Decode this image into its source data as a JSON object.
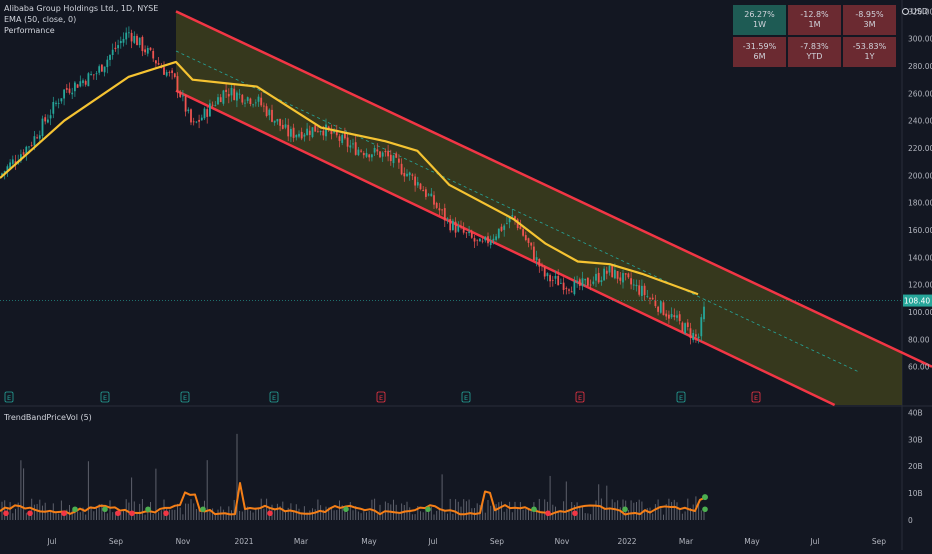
{
  "header": {
    "symbol_line": "Alibaba Group Holdings Ltd., 1D, NYSE",
    "ema_line": "EMA (50, close, 0)",
    "performance_line": "Performance"
  },
  "currency": "USD",
  "performance": [
    {
      "value": "26.27%",
      "period": "1W",
      "color": "#1e5b54"
    },
    {
      "value": "-12.8%",
      "period": "1M",
      "color": "#6b2a31"
    },
    {
      "value": "-8.95%",
      "period": "3M",
      "color": "#6b2a31"
    },
    {
      "value": "-31.59%",
      "period": "6M",
      "color": "#6b2a31"
    },
    {
      "value": "-7.83%",
      "period": "YTD",
      "color": "#6b2a31"
    },
    {
      "value": "-53.83%",
      "period": "1Y",
      "color": "#6b2a31"
    }
  ],
  "sub_pane_label": "TrendBandPriceVol (5)",
  "colors": {
    "background": "#131722",
    "channel": "#f23645",
    "channel_fill": "#3d3e1c",
    "ema": "#f5c332",
    "up": "#26a69a",
    "down": "#ef5350",
    "volume_line": "#f57f17",
    "dot_green": "#4caf50",
    "dot_red": "#f23645"
  },
  "chart_data": [
    {
      "type": "candlestick",
      "title": "Alibaba Group Holdings Ltd., 1D, NYSE",
      "y_axis_ticks": [
        60,
        80,
        100,
        120,
        140,
        160,
        180,
        200,
        220,
        240,
        260,
        280,
        300,
        320
      ],
      "ylim": [
        50,
        325
      ],
      "x_axis_ticks": [
        "Jul",
        "Sep",
        "Nov",
        "2021",
        "Mar",
        "May",
        "Jul",
        "Sep",
        "Nov",
        "2022",
        "Mar",
        "May",
        "Jul",
        "Sep"
      ],
      "last_price_label": "108.40",
      "price_path": [
        {
          "x": "Jun 2020",
          "y": 200
        },
        {
          "x": "Jul 2020",
          "y": 225
        },
        {
          "x": "Aug 2020",
          "y": 262
        },
        {
          "x": "Sep 2020",
          "y": 275
        },
        {
          "x": "Oct 2020",
          "y": 305
        },
        {
          "x": "Nov 2020",
          "y": 268
        },
        {
          "x": "Dec 2020",
          "y": 235
        },
        {
          "x": "Jan 2021",
          "y": 262
        },
        {
          "x": "Feb 2021",
          "y": 255
        },
        {
          "x": "Mar 2021",
          "y": 230
        },
        {
          "x": "Apr 2021",
          "y": 235
        },
        {
          "x": "May 2021",
          "y": 220
        },
        {
          "x": "Jun 2021",
          "y": 215
        },
        {
          "x": "Jul 2021",
          "y": 195
        },
        {
          "x": "Aug 2021",
          "y": 165
        },
        {
          "x": "Sep 2021",
          "y": 148
        },
        {
          "x": "Oct 2021",
          "y": 170
        },
        {
          "x": "Nov 2021",
          "y": 125
        },
        {
          "x": "Dec 2021",
          "y": 118
        },
        {
          "x": "Jan 2022",
          "y": 130
        },
        {
          "x": "Feb 2022",
          "y": 115
        },
        {
          "x": "Mar 2022",
          "y": 80
        },
        {
          "x": "Mar 2022 end",
          "y": 108
        }
      ],
      "ema_path": [
        {
          "x": "Jun 2020",
          "y": 198
        },
        {
          "x": "Aug 2020",
          "y": 240
        },
        {
          "x": "Oct 2020",
          "y": 272
        },
        {
          "x": "Nov 2020",
          "y": 283
        },
        {
          "x": "Dec 2020",
          "y": 270
        },
        {
          "x": "Feb 2021",
          "y": 265
        },
        {
          "x": "Apr 2021",
          "y": 235
        },
        {
          "x": "Jun 2021",
          "y": 225
        },
        {
          "x": "Jul 2021",
          "y": 218
        },
        {
          "x": "Aug 2021",
          "y": 193
        },
        {
          "x": "Oct 2021",
          "y": 168
        },
        {
          "x": "Nov 2021",
          "y": 150
        },
        {
          "x": "Dec 2021",
          "y": 137
        },
        {
          "x": "Jan 2022",
          "y": 135
        },
        {
          "x": "Feb 2022",
          "y": 128
        },
        {
          "x": "Mar 2022",
          "y": 113
        }
      ],
      "channel": {
        "upper": [
          {
            "x": "Nov 2020",
            "y": 320
          },
          {
            "x": "Oct 2022",
            "y": 60
          }
        ],
        "lower": [
          {
            "x": "Nov 2020",
            "y": 262
          },
          {
            "x": "May 2022",
            "y": 50
          }
        ]
      },
      "earnings_markers": [
        "E",
        "E",
        "E",
        "E",
        "E",
        "E",
        "E",
        "E",
        "E",
        "E"
      ]
    },
    {
      "type": "line",
      "title": "TrendBandPriceVol (5)",
      "y_axis_ticks": [
        "0",
        "10B",
        "20B",
        "30B",
        "40B"
      ],
      "ylim": [
        -3,
        40
      ]
    }
  ]
}
